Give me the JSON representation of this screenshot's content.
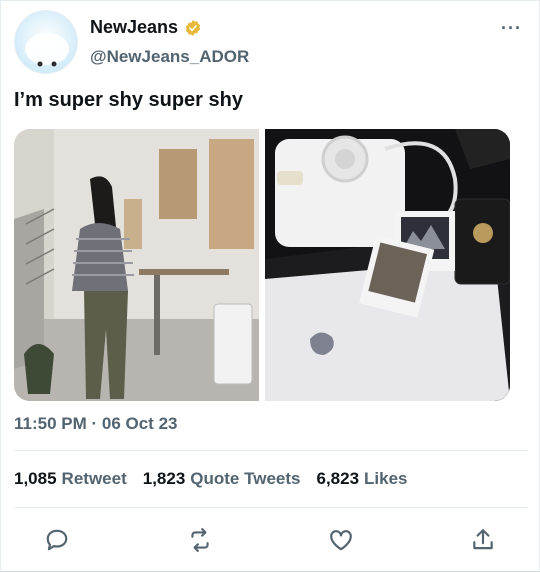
{
  "author": {
    "display_name": "NewJeans",
    "handle": "@NewJeans_ADOR",
    "verified_color": "#e8b83a"
  },
  "tweet": {
    "text": "I’m super shy super shy",
    "timestamp": "11:50 PM · 06 Oct 23"
  },
  "stats": {
    "retweets": {
      "count": "1,085",
      "label": "Retweet"
    },
    "quotes": {
      "count": "1,823",
      "label": "Quote Tweets"
    },
    "likes": {
      "count": "6,823",
      "label": "Likes"
    }
  },
  "actions": [
    "reply-icon",
    "retweet-icon",
    "like-icon",
    "share-icon"
  ],
  "colors": {
    "text_primary": "#0f1419",
    "text_secondary": "#536471",
    "divider": "#e6ecf0"
  }
}
